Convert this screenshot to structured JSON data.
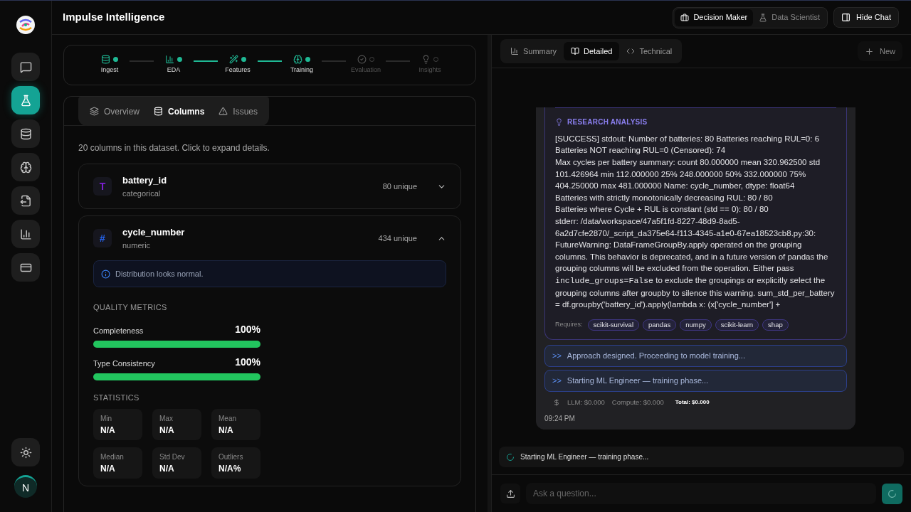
{
  "app": {
    "title": "Impulse Intelligence",
    "avatar": "N"
  },
  "sidebar": {
    "items": [
      {
        "selected": false
      },
      {
        "selected": true
      },
      {
        "selected": false
      },
      {
        "selected": false
      },
      {
        "selected": false
      },
      {
        "selected": false
      },
      {
        "selected": false
      }
    ]
  },
  "mode_toggle": [
    {
      "label": "Decision Maker",
      "selected": true
    },
    {
      "label": "Data Scientist",
      "selected": false
    }
  ],
  "hide_chat": "Hide Chat",
  "pipeline": [
    {
      "label": "Ingest",
      "done": true
    },
    {
      "label": "EDA",
      "done": true
    },
    {
      "label": "Features",
      "done": true
    },
    {
      "label": "Training",
      "done": true
    },
    {
      "label": "Evaluation",
      "done": false
    },
    {
      "label": "Insights",
      "done": false
    }
  ],
  "pipeline_connectors": [
    {
      "active": false
    },
    {
      "active": true
    },
    {
      "active": true
    },
    {
      "active": false
    },
    {
      "active": false
    }
  ],
  "data_tabs": [
    {
      "label": "Overview",
      "selected": false
    },
    {
      "label": "Columns",
      "selected": true
    },
    {
      "label": "Issues",
      "selected": false
    }
  ],
  "columns_intro": "20 columns in this dataset. Click to expand details.",
  "columns": [
    {
      "name": "battery_id",
      "type": "categorical",
      "icon": "T",
      "color": "#7c1fd1",
      "unique": "80 unique",
      "expanded": false
    },
    {
      "name": "cycle_number",
      "type": "numeric",
      "icon": "#",
      "color": "#2563eb",
      "unique": "434 unique",
      "expanded": true,
      "note": "Distribution looks normal.",
      "quality_title": "QUALITY METRICS",
      "metrics": [
        {
          "label": "Completeness",
          "value": "100%",
          "level": 1
        },
        {
          "label": "Type Consistency",
          "value": "100%",
          "level": 1
        }
      ],
      "stats_title": "STATISTICS",
      "stats": [
        {
          "label": "Min",
          "value": "N/A"
        },
        {
          "label": "Max",
          "value": "N/A"
        },
        {
          "label": "Mean",
          "value": "N/A"
        },
        {
          "label": "Median",
          "value": "N/A"
        },
        {
          "label": "Std Dev",
          "value": "N/A"
        },
        {
          "label": "Outliers",
          "value": "N/A%"
        }
      ]
    }
  ],
  "chat_tabs": [
    {
      "label": "Summary",
      "selected": false
    },
    {
      "label": "Detailed",
      "selected": true
    },
    {
      "label": "Technical",
      "selected": false
    }
  ],
  "new_button": "New",
  "message": {
    "section_title": "RESEARCH ANALYSIS",
    "text_before": "[SUCCESS] stdout: Number of batteries: 80 Batteries reaching RUL=0: 6 Batteries NOT reaching RUL=0 (Censored): 74\nMax cycles per battery summary: count 80.000000 mean 320.962500 std 101.426964 min 112.000000 25% 248.000000 50% 332.000000 75% 404.250000 max 481.000000 Name: cycle_number, dtype: float64\nBatteries with strictly monotonically decreasing RUL: 80 / 80\nBatteries where Cycle + RUL is constant (std == 0): 80 / 80\nstderr: /data/workspace/47a5f1fd-8227-48d9-8ad5-6a2d7cfe2870/_script_da375e64-f113-4345-a1e0-67ea18523cb8.py:30: FutureWarning: DataFrameGroupBy.apply operated on the grouping columns. This behavior is deprecated, and in a future version of pandas the grouping columns will be excluded from the operation. Either pass ",
    "code": "include_groups=False",
    "text_after": " to exclude the groupings or explicitly select the grouping columns after groupby to silence this warning. sum_std_per_battery = df.groupby('battery_id').apply(lambda x: (x['cycle_number'] +",
    "requires_label": "Requires:",
    "requires": [
      "scikit-survival",
      "pandas",
      "numpy",
      "scikit-learn",
      "shap"
    ],
    "steps": [
      {
        "prefix": ">>",
        "text": "Approach designed. Proceeding to model training..."
      },
      {
        "prefix": ">>",
        "text": "Starting ML Engineer — training phase..."
      }
    ],
    "costs": {
      "llm": "LLM: $0.000",
      "compute": "Compute: $0.000",
      "total": "Total: $0.000"
    },
    "time": "09:24 PM"
  },
  "status": "Starting ML Engineer — training phase...",
  "input": {
    "placeholder": "Ask a question..."
  }
}
